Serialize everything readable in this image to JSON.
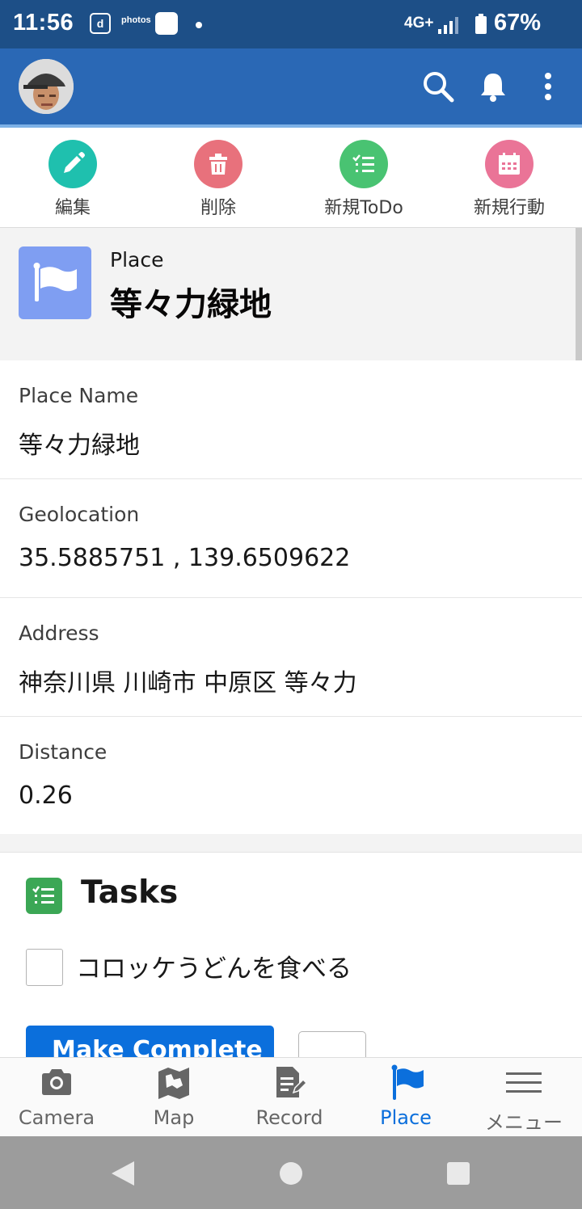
{
  "status_bar": {
    "time": "11:56",
    "app_icon_1": "d",
    "app_icon_2": "photos",
    "network": "4G+",
    "battery_percent": "67%"
  },
  "app_bar": {
    "avatar": "user-avatar",
    "icons": [
      "search-icon",
      "bell-icon",
      "more-vert-icon"
    ]
  },
  "actions": [
    {
      "label": "編集",
      "icon": "pencil-icon",
      "color": "#1fc0ae"
    },
    {
      "label": "削除",
      "icon": "trash-icon",
      "color": "#e8717c"
    },
    {
      "label": "新規ToDo",
      "icon": "task-list-icon",
      "color": "#49c372"
    },
    {
      "label": "新規行動",
      "icon": "calendar-icon",
      "color": "#ea7497"
    }
  ],
  "record": {
    "type": "Place",
    "title": "等々力緑地",
    "icon_color": "#7f9ef2"
  },
  "fields": [
    {
      "label": "Place Name",
      "value": "等々力緑地"
    },
    {
      "label": "Geolocation",
      "value": "35.5885751 , 139.6509622"
    },
    {
      "label": "Address",
      "value": "神奈川県 川崎市 中原区 等々力"
    },
    {
      "label": "Distance",
      "value": "0.26"
    }
  ],
  "tasks": {
    "title": "Tasks",
    "items": [
      {
        "text": "コロッケうどんを食べる",
        "checked": false
      }
    ],
    "primary_button": "Make Complete"
  },
  "bottom_nav": {
    "active_index": 3,
    "items": [
      {
        "label": "Camera",
        "icon": "camera-icon"
      },
      {
        "label": "Map",
        "icon": "map-icon"
      },
      {
        "label": "Record",
        "icon": "record-icon"
      },
      {
        "label": "Place",
        "icon": "flag-icon"
      },
      {
        "label": "メニュー",
        "icon": "hamburger-icon"
      }
    ]
  },
  "colors": {
    "status_bar": "#1d4f87",
    "app_bar": "#2a68b5",
    "brand_blue": "#0b6fdc"
  }
}
